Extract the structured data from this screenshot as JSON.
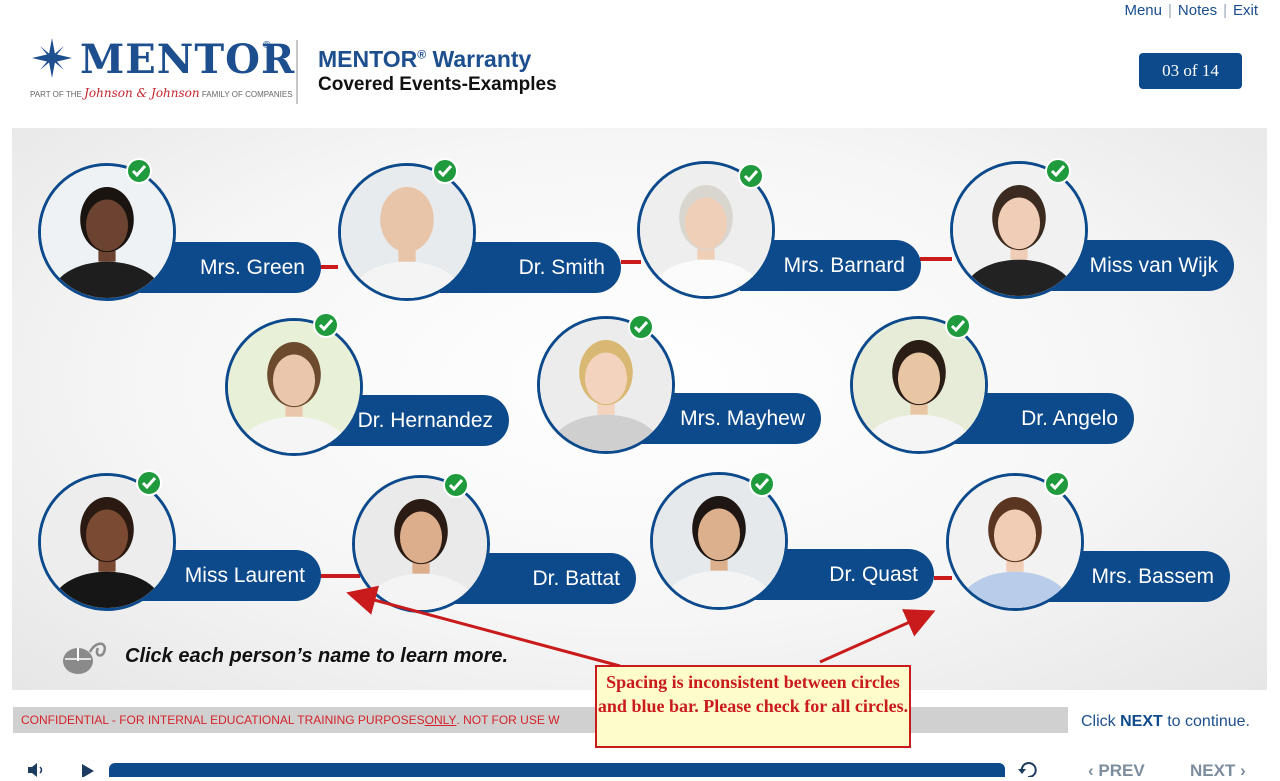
{
  "nav": {
    "menu": "Menu",
    "notes": "Notes",
    "exit": "Exit",
    "sep": "|"
  },
  "logo": {
    "word": "MENTOR",
    "reg": "®",
    "sub_prefix": "PART OF THE ",
    "sub_brand": "Johnson & Johnson",
    "sub_suffix": " FAMILY OF COMPANIES"
  },
  "header": {
    "title": "MENTOR",
    "title_reg": "®",
    "title_rest": " Warranty",
    "subtitle": "Covered Events-Examples"
  },
  "counter": "03 of 14",
  "people": [
    {
      "name": "Mrs. Green",
      "skin": "#6b4330",
      "hair": "#1a1410",
      "shirt": "#1e1e1e",
      "bg": "#eef2f5",
      "completed": true
    },
    {
      "name": "Dr. Smith",
      "skin": "#e8c4a8",
      "hair": "#e8c4a8",
      "shirt": "#f4f4f4",
      "bg": "#e7ebee",
      "completed": true
    },
    {
      "name": "Mrs. Barnard",
      "skin": "#f0cfb8",
      "hair": "#d9d6cf",
      "shirt": "#fbfbfb",
      "bg": "#eeeeee",
      "completed": true
    },
    {
      "name": "Miss van Wijk",
      "skin": "#f0cdb6",
      "hair": "#3b2a20",
      "shirt": "#222222",
      "bg": "#f1f1f1",
      "completed": true
    },
    {
      "name": "Dr. Hernandez",
      "skin": "#eac7ac",
      "hair": "#6b4a2e",
      "shirt": "#f5f5f5",
      "bg": "#e9f0d8",
      "completed": true
    },
    {
      "name": "Mrs. Mayhew",
      "skin": "#f3d3bd",
      "hair": "#d8b873",
      "shirt": "#cfcfcf",
      "bg": "#ececec",
      "completed": true
    },
    {
      "name": "Dr. Angelo",
      "skin": "#e9c6a3",
      "hair": "#2a1d16",
      "shirt": "#f5f5f5",
      "bg": "#e7ecd9",
      "completed": true
    },
    {
      "name": "Miss Laurent",
      "skin": "#7a4a32",
      "hair": "#2a1a12",
      "shirt": "#161616",
      "bg": "#ededed",
      "completed": true
    },
    {
      "name": "Dr. Battat",
      "skin": "#dcae8c",
      "hair": "#2a1c14",
      "shirt": "#f4f4f4",
      "bg": "#eaeaea",
      "completed": true
    },
    {
      "name": "Dr. Quast",
      "skin": "#dcb08c",
      "hair": "#1e1612",
      "shirt": "#f4f4f4",
      "bg": "#e6e9ec",
      "completed": true
    },
    {
      "name": "Mrs. Bassem",
      "skin": "#f0cdb4",
      "hair": "#5a3522",
      "shirt": "#b9cdea",
      "bg": "#f2f2f2",
      "completed": true
    }
  ],
  "instruction": "Click each person’s name to learn more.",
  "confidential": {
    "prefix": "CONFIDENTIAL - FOR INTERNAL EDUCATIONAL TRAINING PURPOSES ",
    "only": "ONLY",
    "suffix": ". NOT FOR USE W"
  },
  "click_next": {
    "prefix": "Click ",
    "next": "NEXT",
    "suffix": " to continue."
  },
  "annotation": "Spacing is inconsistent between circles and blue bar. Please check for all circles.",
  "player": {
    "prev": "PREV",
    "next": "NEXT"
  },
  "colors": {
    "brand_blue": "#0d4a8c",
    "check_green": "#1f9a3c",
    "annotation_red": "#c91b1b"
  }
}
